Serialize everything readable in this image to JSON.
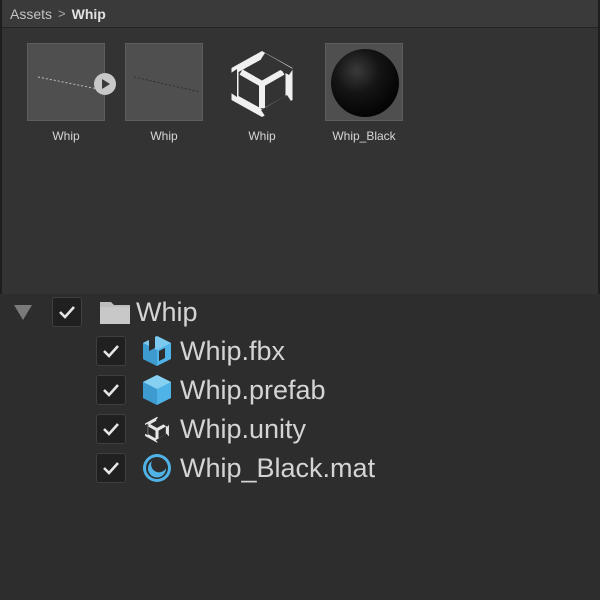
{
  "breadcrumb": {
    "root": "Assets",
    "separator": ">",
    "current": "Whip"
  },
  "assets": [
    {
      "label": "Whip",
      "kind": "animation-clip"
    },
    {
      "label": "Whip",
      "kind": "fbx-model"
    },
    {
      "label": "Whip",
      "kind": "unity-scene"
    },
    {
      "label": "Whip_Black",
      "kind": "material"
    }
  ],
  "import_tree": {
    "folder": {
      "label": "Whip",
      "checked": true,
      "expanded": true
    },
    "items": [
      {
        "label": "Whip.fbx",
        "checked": true,
        "icon": "fbx-model-icon"
      },
      {
        "label": "Whip.prefab",
        "checked": true,
        "icon": "prefab-icon"
      },
      {
        "label": "Whip.unity",
        "checked": true,
        "icon": "unity-logo-icon"
      },
      {
        "label": "Whip_Black.mat",
        "checked": true,
        "icon": "material-icon"
      }
    ]
  },
  "colors": {
    "prefab_blue": "#4fb3e8",
    "panel_bg": "#333333",
    "list_bg": "#2d2d2d"
  }
}
